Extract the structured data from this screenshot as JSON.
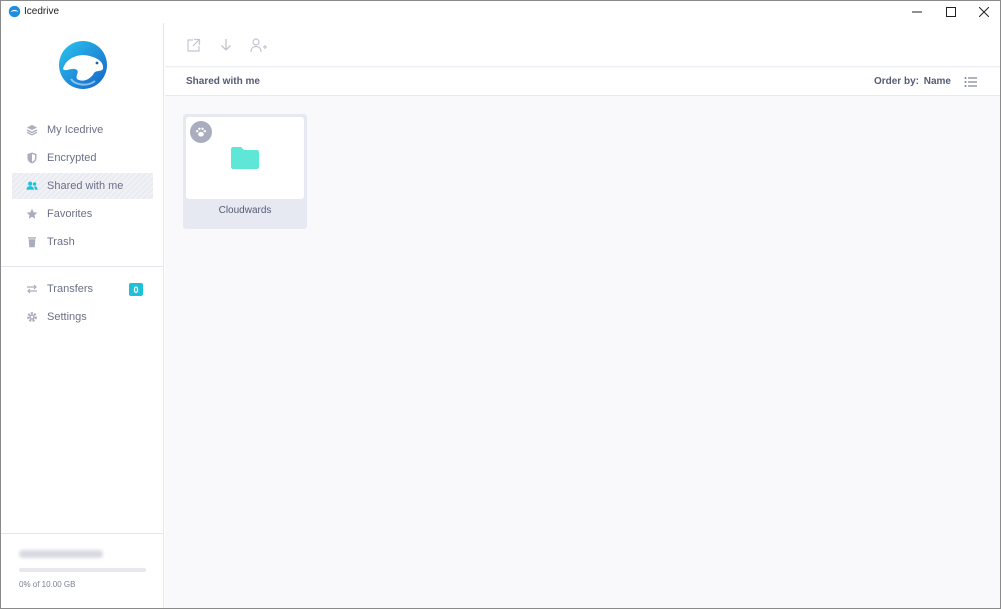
{
  "window": {
    "title": "Icedrive",
    "minimize_icon": "minimize-icon",
    "maximize_icon": "maximize-icon",
    "close_icon": "close-icon"
  },
  "sidebar": {
    "items": [
      {
        "label": "My Icedrive",
        "icon": "layers-icon",
        "active": false
      },
      {
        "label": "Encrypted",
        "icon": "shield-icon",
        "active": false
      },
      {
        "label": "Shared with me",
        "icon": "users-icon",
        "active": true
      },
      {
        "label": "Favorites",
        "icon": "star-icon",
        "active": false
      },
      {
        "label": "Trash",
        "icon": "trash-icon",
        "active": false
      }
    ],
    "secondary": [
      {
        "label": "Transfers",
        "icon": "transfer-arrows-icon",
        "badge": "0"
      },
      {
        "label": "Settings",
        "icon": "gear-icon"
      }
    ],
    "storage": {
      "text": "0% of 10.00 GB",
      "used_fraction": 0.0
    }
  },
  "toolbar": {
    "buttons": [
      "open-external-icon",
      "download-icon",
      "add-user-icon"
    ]
  },
  "breadcrumb": {
    "current": "Shared with me"
  },
  "order": {
    "label": "Order by:",
    "value": "Name"
  },
  "items": [
    {
      "name": "Cloudwards",
      "type": "folder"
    }
  ],
  "colors": {
    "accent": "#1fc1d9",
    "folder": "#5ee6d6",
    "text": "#555c75",
    "active_bg": "#eceef3"
  }
}
